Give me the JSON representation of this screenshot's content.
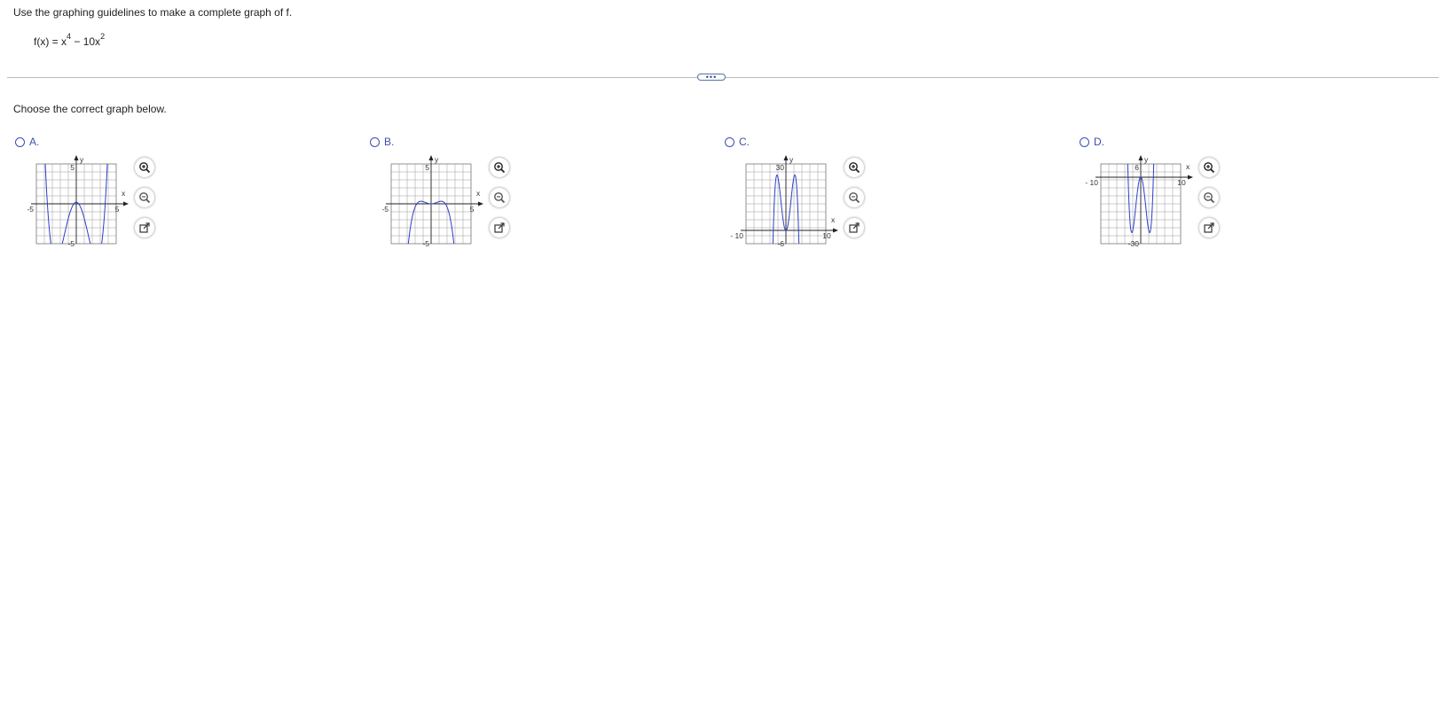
{
  "question": {
    "instruction": "Use the graphing guidelines to make a complete graph of f.",
    "formula": {
      "lhs": "f(x) = x",
      "exp1": "4",
      "mid": " − 10x",
      "exp2": "2"
    },
    "more_label": "•••",
    "prompt": "Choose the correct graph below."
  },
  "options": [
    {
      "letter": "A.",
      "tick_labels": {
        "xmin": "-5",
        "xmax": "5",
        "ymax": "5",
        "ymin": "-5"
      },
      "axis_x": "x",
      "axis_y": "y"
    },
    {
      "letter": "B.",
      "tick_labels": {
        "xmin": "-5",
        "xmax": "5",
        "ymax": "5",
        "ymin": "-5"
      },
      "axis_x": "x",
      "axis_y": "y"
    },
    {
      "letter": "C.",
      "tick_labels": {
        "xmin": "- 10",
        "xmax": "10",
        "ymax": "30",
        "ymin": "-6"
      },
      "axis_x": "x",
      "axis_y": "y"
    },
    {
      "letter": "D.",
      "tick_labels": {
        "xmin": "- 10",
        "xmax": "10",
        "ymax": "6",
        "ymin": "-30"
      },
      "axis_x": "x",
      "axis_y": "y"
    }
  ],
  "chart_data": [
    {
      "type": "line",
      "option": "A",
      "function": "y = -x^4 + 10x^2",
      "xlim": [
        -5,
        5
      ],
      "ylim": [
        -5,
        5
      ],
      "grid": true,
      "curve_color": "#2b3fc7"
    },
    {
      "type": "line",
      "option": "B",
      "function": "y = -x^4 + 10x^2",
      "xlim": [
        -5,
        5
      ],
      "ylim": [
        -5,
        5
      ],
      "grid": true,
      "curve_color": "#2b3fc7"
    },
    {
      "type": "line",
      "option": "C",
      "function": "y = -x^4 + 10x^2",
      "xlim": [
        -10,
        10
      ],
      "ylim": [
        -6,
        30
      ],
      "grid": true,
      "curve_color": "#2b3fc7"
    },
    {
      "type": "line",
      "option": "D",
      "function": "y = x^4 - 10x^2",
      "xlim": [
        -10,
        10
      ],
      "ylim": [
        -30,
        6
      ],
      "grid": true,
      "curve_color": "#2b3fc7"
    }
  ],
  "tools": {
    "zoom_in": "zoom-in-icon",
    "zoom_out": "zoom-out-icon",
    "popout": "external-window-icon"
  },
  "colors": {
    "accent": "#3b4fb0",
    "grid": "#9a9a9a",
    "curve": "#2b3fc7"
  }
}
